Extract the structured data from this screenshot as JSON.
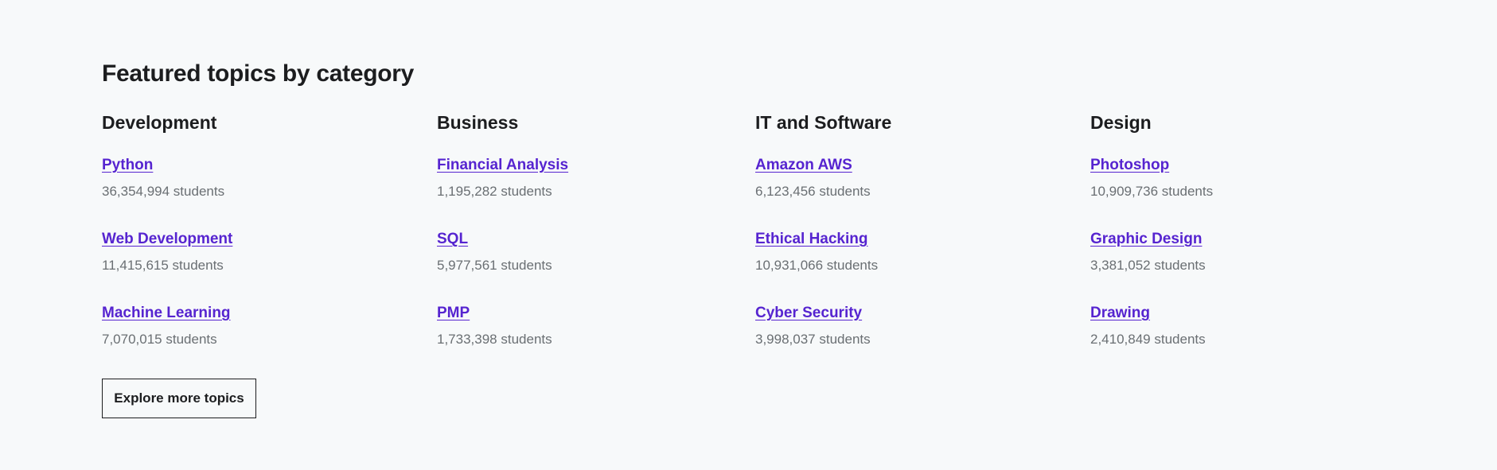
{
  "section": {
    "title": "Featured topics by category",
    "explore_label": "Explore more topics"
  },
  "categories": [
    {
      "name": "Development",
      "topics": [
        {
          "label": "Python",
          "students": "36,354,994 students"
        },
        {
          "label": "Web Development",
          "students": "11,415,615 students"
        },
        {
          "label": "Machine Learning",
          "students": "7,070,015 students"
        }
      ]
    },
    {
      "name": "Business",
      "topics": [
        {
          "label": "Financial Analysis",
          "students": "1,195,282 students"
        },
        {
          "label": "SQL",
          "students": "5,977,561 students"
        },
        {
          "label": "PMP",
          "students": "1,733,398 students"
        }
      ]
    },
    {
      "name": "IT and Software",
      "topics": [
        {
          "label": "Amazon AWS",
          "students": "6,123,456 students"
        },
        {
          "label": "Ethical Hacking",
          "students": "10,931,066 students"
        },
        {
          "label": "Cyber Security",
          "students": "3,998,037 students"
        }
      ]
    },
    {
      "name": "Design",
      "topics": [
        {
          "label": "Photoshop",
          "students": "10,909,736 students"
        },
        {
          "label": "Graphic Design",
          "students": "3,381,052 students"
        },
        {
          "label": "Drawing",
          "students": "2,410,849 students"
        }
      ]
    }
  ],
  "colors": {
    "background": "#f7f9fa",
    "link": "#5624d0",
    "text": "#1c1d1f",
    "muted": "#6a6f73"
  }
}
